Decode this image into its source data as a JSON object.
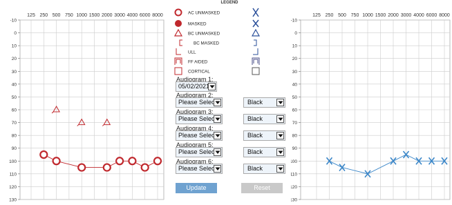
{
  "legend": {
    "title": "LEGEND",
    "items": [
      {
        "label": "AC UNMASKED",
        "left_icon": "red-circle-icon",
        "right_icon": "blue-x-icon"
      },
      {
        "label": "MASKED",
        "left_icon": "red-filled-circle-icon",
        "right_icon": "blue-x-bold-icon"
      },
      {
        "label": "BC UNMASKED",
        "left_icon": "red-triangle-icon",
        "right_icon": "blue-triangle-icon"
      },
      {
        "label": "BC MASKED",
        "left_icon": "red-bracket-left-icon",
        "right_icon": "blue-bracket-right-icon"
      },
      {
        "label": "ULL",
        "left_icon": "red-ull-icon",
        "right_icon": "blue-ull-icon"
      },
      {
        "label": "FF AIDED",
        "left_icon": "red-ff-aided-icon",
        "right_icon": "blue-ff-aided-icon"
      },
      {
        "label": "CORTICAL",
        "left_icon": "red-square-icon",
        "right_icon": "blue-square-icon"
      }
    ]
  },
  "controls": {
    "audiogram1_label": "Audiogram 1:",
    "audiogram1_value": "05/02/2021",
    "rows": [
      {
        "label": "Audiogram 2:",
        "select": "Please Select",
        "color": "Black"
      },
      {
        "label": "Audiogram 3:",
        "select": "Please Select",
        "color": "Black"
      },
      {
        "label": "Audiogram 4:",
        "select": "Please Select",
        "color": "Black"
      },
      {
        "label": "Audiogram 5:",
        "select": "Please Select",
        "color": "Black"
      },
      {
        "label": "Audiogram 6:",
        "select": "Please Select",
        "color": "Black"
      }
    ],
    "update_label": "Update",
    "reset_label": "Reset"
  },
  "colors": {
    "left_ear": "#c0282d",
    "right_ear": "#3a86c8",
    "grid": "#cccccc",
    "update_button": "#6fa2d0",
    "reset_button": "#c9c9c9"
  },
  "chart_data": [
    {
      "type": "line",
      "ear": "left",
      "x_ticks": [
        125,
        250,
        500,
        750,
        1000,
        1500,
        2000,
        3000,
        4000,
        6000,
        8000
      ],
      "x_tick_labels": [
        "125",
        "250",
        "500",
        "750",
        "1000",
        "1500",
        "2000",
        "3000",
        "4000",
        "6000",
        "8000"
      ],
      "y_ticks": [
        -10,
        0,
        10,
        20,
        30,
        40,
        50,
        60,
        70,
        80,
        90,
        100,
        110,
        120,
        130
      ],
      "ylim": [
        -10,
        130
      ],
      "y_inverted": true,
      "grid": true,
      "series": [
        {
          "symbol": "circle",
          "color": "#c0282d",
          "connected": true,
          "x": [
            250,
            500,
            1000,
            2000,
            3000,
            4000,
            6000,
            8000
          ],
          "y": [
            95,
            100,
            105,
            105,
            100,
            100,
            105,
            100
          ]
        },
        {
          "symbol": "triangle",
          "color": "#c0282d",
          "connected": false,
          "x": [
            500,
            1000,
            2000
          ],
          "y": [
            60,
            70,
            70
          ]
        }
      ]
    },
    {
      "type": "line",
      "ear": "right",
      "x_ticks": [
        125,
        250,
        500,
        750,
        1000,
        1500,
        2000,
        3000,
        4000,
        6000,
        8000
      ],
      "x_tick_labels": [
        "125",
        "250",
        "500",
        "750",
        "1000",
        "1500",
        "2000",
        "3000",
        "4000",
        "6000",
        "8000"
      ],
      "y_ticks": [
        -10,
        0,
        10,
        20,
        30,
        40,
        50,
        60,
        70,
        80,
        90,
        100,
        110,
        120,
        130
      ],
      "ylim": [
        -10,
        130
      ],
      "y_inverted": true,
      "grid": true,
      "series": [
        {
          "symbol": "x",
          "color": "#3a86c8",
          "connected": true,
          "x": [
            250,
            500,
            1000,
            2000,
            3000,
            4000,
            6000,
            8000
          ],
          "y": [
            100,
            105,
            110,
            100,
            95,
            100,
            100,
            100
          ]
        }
      ]
    }
  ]
}
